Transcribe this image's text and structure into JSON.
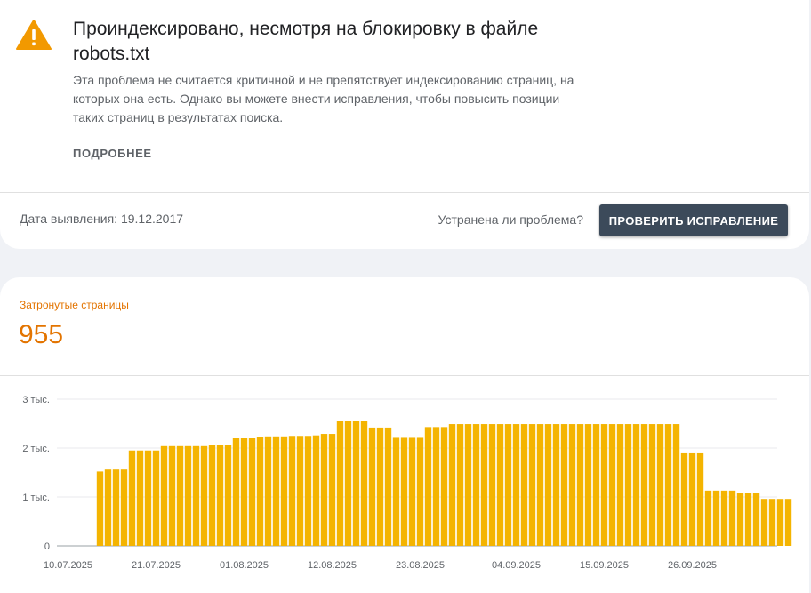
{
  "issue": {
    "title": "Проиндексировано, несмотря на блокировку в файле robots.txt",
    "description": "Эта проблема не считается критичной и не препятствует индексированию страниц, на которых она есть. Однако вы можете внести исправления, чтобы повысить позиции таких страниц в результатах поиска.",
    "learn_more": "ПОДРОБНЕЕ",
    "icon": "warning-icon",
    "accent_color": "#f29900"
  },
  "detection": {
    "date_text": "Дата выявления: 19.12.2017"
  },
  "validation": {
    "question": "Устранена ли проблема?",
    "button_label": "ПРОВЕРИТЬ ИСПРАВЛЕНИЕ"
  },
  "metric": {
    "label": "Затронутые страницы",
    "value": "955",
    "color": "#e37400"
  },
  "chart_data": {
    "type": "bar",
    "bar_color": "#f4b400",
    "ylim": [
      0,
      3000
    ],
    "y_ticks": [
      {
        "value": 0,
        "label": "0"
      },
      {
        "value": 1000,
        "label": "1 тыс."
      },
      {
        "value": 2000,
        "label": "2 тыс."
      },
      {
        "value": 3000,
        "label": "3 тыс."
      }
    ],
    "x_ticks": [
      {
        "index": 0,
        "label": "10.07.2025"
      },
      {
        "index": 11,
        "label": "21.07.2025"
      },
      {
        "index": 22,
        "label": "01.08.2025"
      },
      {
        "index": 33,
        "label": "12.08.2025"
      },
      {
        "index": 44,
        "label": "23.08.2025"
      },
      {
        "index": 56,
        "label": "04.09.2025"
      },
      {
        "index": 67,
        "label": "15.09.2025"
      },
      {
        "index": 78,
        "label": "26.09.2025"
      }
    ],
    "start_date": "10.07.2025",
    "values": [
      null,
      null,
      null,
      null,
      1520,
      1560,
      1560,
      1560,
      1950,
      1950,
      1950,
      1950,
      2040,
      2040,
      2040,
      2040,
      2040,
      2040,
      2060,
      2060,
      2060,
      2200,
      2200,
      2200,
      2220,
      2240,
      2240,
      2240,
      2250,
      2250,
      2250,
      2260,
      2290,
      2290,
      2560,
      2560,
      2560,
      2560,
      2420,
      2420,
      2420,
      2210,
      2210,
      2210,
      2210,
      2430,
      2430,
      2430,
      2490,
      2490,
      2490,
      2490,
      2490,
      2490,
      2490,
      2490,
      2490,
      2490,
      2490,
      2490,
      2490,
      2490,
      2490,
      2490,
      2490,
      2490,
      2490,
      2490,
      2490,
      2490,
      2490,
      2490,
      2490,
      2490,
      2490,
      2490,
      2490,
      1910,
      1910,
      1910,
      1130,
      1130,
      1130,
      1130,
      1080,
      1080,
      1080,
      960,
      960,
      960,
      960
    ]
  }
}
